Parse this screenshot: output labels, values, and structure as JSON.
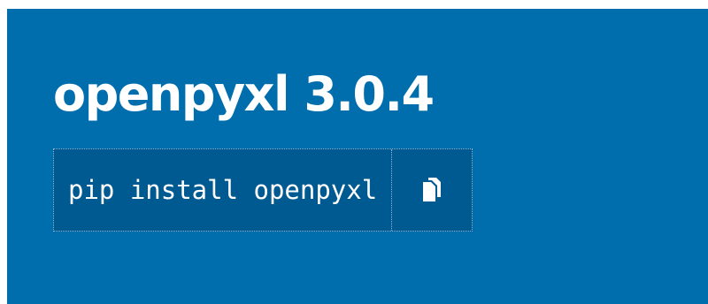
{
  "header": {
    "title": "openpyxl 3.0.4",
    "pip_command": "pip install openpyxl",
    "copy_icon": "copy-icon"
  },
  "colors": {
    "banner_bg": "#006dad",
    "command_bg": "#005a92",
    "text": "#ffffff"
  }
}
